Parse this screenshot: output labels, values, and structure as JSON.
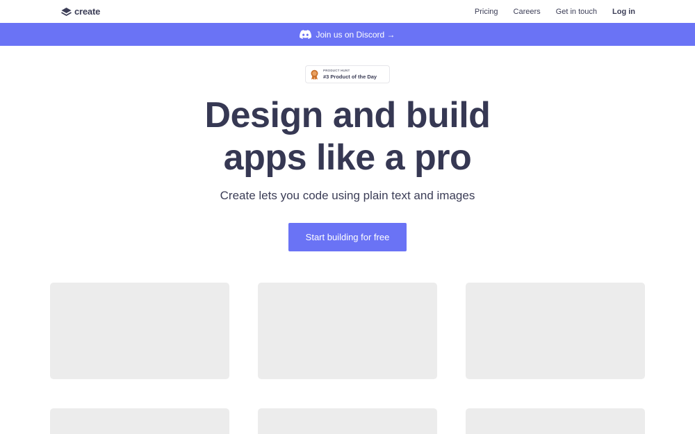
{
  "nav": {
    "logo_text": "create",
    "links": [
      "Pricing",
      "Careers",
      "Get in touch"
    ],
    "login": "Log in"
  },
  "banner": {
    "text": "Join us on Discord →",
    "color": "#6a73f5"
  },
  "product_hunt": {
    "label": "PRODUCT HUNT",
    "title": "#3 Product of the Day"
  },
  "hero": {
    "title_line1": "Design and build",
    "title_line2": "apps like a pro",
    "subtitle": "Create lets you code using plain text and images",
    "cta": "Start building for free"
  },
  "colors": {
    "accent": "#6a73f5",
    "text": "#363853",
    "placeholder": "#ececec"
  },
  "icons": [
    "create-logo-icon",
    "discord-icon",
    "medal-icon"
  ]
}
